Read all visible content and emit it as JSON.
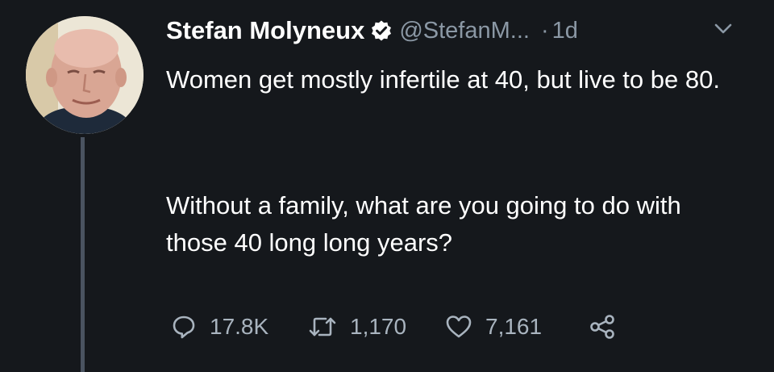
{
  "tweet": {
    "display_name": "Stefan Molyneux",
    "handle": "@StefanM...",
    "separator": "·",
    "time": "1d",
    "paragraphs": [
      "Women get mostly infertile at 40, but live to be 80.",
      "Without a family, what are you going to do with those 40 long long years?"
    ],
    "actions": {
      "replies": "17.8K",
      "retweets": "1,170",
      "likes": "7,161"
    }
  },
  "icons": {
    "verified": "verified-badge-icon",
    "caret": "chevron-down-icon",
    "reply": "reply-bubble-icon",
    "retweet": "retweet-icon",
    "like": "heart-icon",
    "share": "share-icon"
  },
  "colors": {
    "background": "#15181c",
    "text": "#ffffff",
    "secondary_text": "#8b98a5",
    "thread_line": "#4a5360"
  }
}
